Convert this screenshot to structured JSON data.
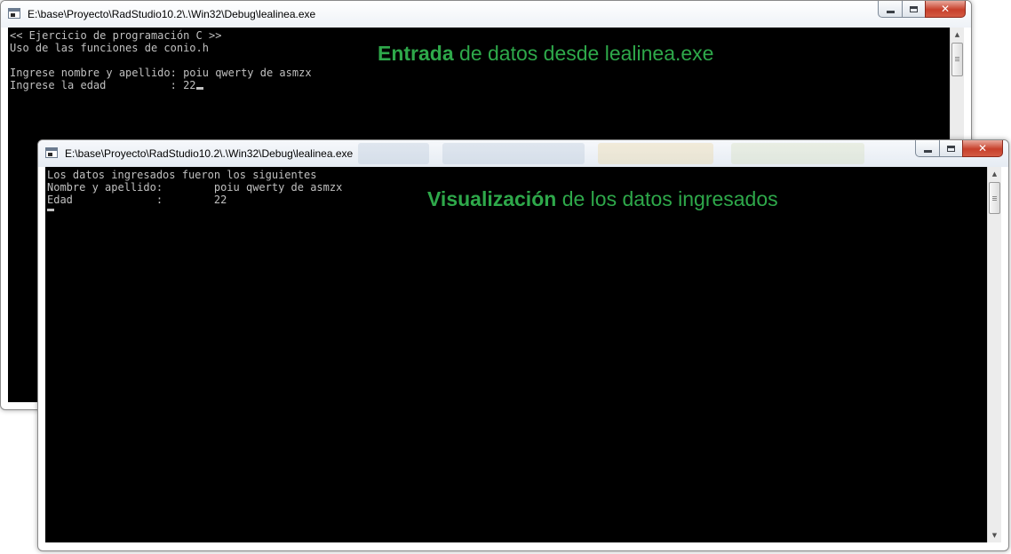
{
  "window_back": {
    "title": "E:\\base\\Proyecto\\RadStudio10.2\\.\\Win32\\Debug\\lealinea.exe",
    "console_text": "<< Ejercicio de programación C >>\nUso de las funciones de conio.h\n\nIngrese nombre y apellido: poiu qwerty de asmzx\nIngrese la edad          : 22",
    "caption_bold": "Entrada",
    "caption_rest": " de datos desde lealinea.exe"
  },
  "window_front": {
    "title": "E:\\base\\Proyecto\\RadStudio10.2\\.\\Win32\\Debug\\lealinea.exe",
    "console_text": "Los datos ingresados fueron los siguientes\nNombre y apellido:        poiu qwerty de asmzx\nEdad             :        22",
    "caption_bold": "Visualización",
    "caption_rest": " de los datos ingresados"
  },
  "colors": {
    "caption_green": "#2ea84a",
    "console_bg": "#000000",
    "console_text": "#c0c0c0",
    "close_button_red": "#c7402b"
  },
  "icons": {
    "window": "console-window-icon",
    "minimize": "minimize-icon",
    "maximize": "maximize-icon",
    "close": "close-icon",
    "scroll_up": "scroll-up-arrow-icon",
    "scroll_down": "scroll-down-arrow-icon"
  }
}
